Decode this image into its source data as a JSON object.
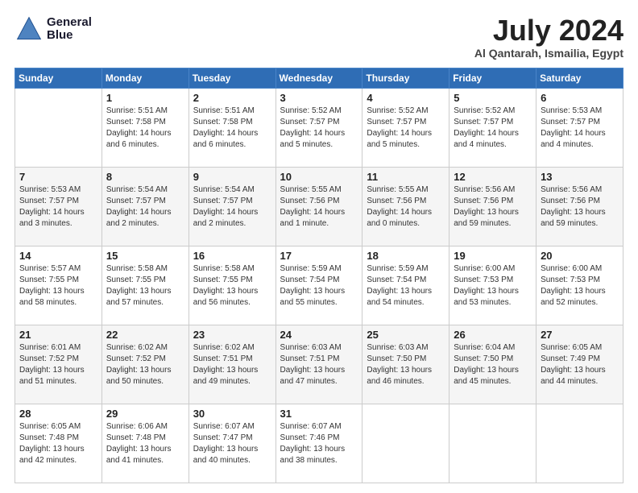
{
  "header": {
    "logo_line1": "General",
    "logo_line2": "Blue",
    "month_year": "July 2024",
    "location": "Al Qantarah, Ismailia, Egypt"
  },
  "weekdays": [
    "Sunday",
    "Monday",
    "Tuesday",
    "Wednesday",
    "Thursday",
    "Friday",
    "Saturday"
  ],
  "weeks": [
    [
      {
        "day": "",
        "sunrise": "",
        "sunset": "",
        "daylight": ""
      },
      {
        "day": "1",
        "sunrise": "Sunrise: 5:51 AM",
        "sunset": "Sunset: 7:58 PM",
        "daylight": "Daylight: 14 hours and 6 minutes."
      },
      {
        "day": "2",
        "sunrise": "Sunrise: 5:51 AM",
        "sunset": "Sunset: 7:58 PM",
        "daylight": "Daylight: 14 hours and 6 minutes."
      },
      {
        "day": "3",
        "sunrise": "Sunrise: 5:52 AM",
        "sunset": "Sunset: 7:57 PM",
        "daylight": "Daylight: 14 hours and 5 minutes."
      },
      {
        "day": "4",
        "sunrise": "Sunrise: 5:52 AM",
        "sunset": "Sunset: 7:57 PM",
        "daylight": "Daylight: 14 hours and 5 minutes."
      },
      {
        "day": "5",
        "sunrise": "Sunrise: 5:52 AM",
        "sunset": "Sunset: 7:57 PM",
        "daylight": "Daylight: 14 hours and 4 minutes."
      },
      {
        "day": "6",
        "sunrise": "Sunrise: 5:53 AM",
        "sunset": "Sunset: 7:57 PM",
        "daylight": "Daylight: 14 hours and 4 minutes."
      }
    ],
    [
      {
        "day": "7",
        "sunrise": "Sunrise: 5:53 AM",
        "sunset": "Sunset: 7:57 PM",
        "daylight": "Daylight: 14 hours and 3 minutes."
      },
      {
        "day": "8",
        "sunrise": "Sunrise: 5:54 AM",
        "sunset": "Sunset: 7:57 PM",
        "daylight": "Daylight: 14 hours and 2 minutes."
      },
      {
        "day": "9",
        "sunrise": "Sunrise: 5:54 AM",
        "sunset": "Sunset: 7:57 PM",
        "daylight": "Daylight: 14 hours and 2 minutes."
      },
      {
        "day": "10",
        "sunrise": "Sunrise: 5:55 AM",
        "sunset": "Sunset: 7:56 PM",
        "daylight": "Daylight: 14 hours and 1 minute."
      },
      {
        "day": "11",
        "sunrise": "Sunrise: 5:55 AM",
        "sunset": "Sunset: 7:56 PM",
        "daylight": "Daylight: 14 hours and 0 minutes."
      },
      {
        "day": "12",
        "sunrise": "Sunrise: 5:56 AM",
        "sunset": "Sunset: 7:56 PM",
        "daylight": "Daylight: 13 hours and 59 minutes."
      },
      {
        "day": "13",
        "sunrise": "Sunrise: 5:56 AM",
        "sunset": "Sunset: 7:56 PM",
        "daylight": "Daylight: 13 hours and 59 minutes."
      }
    ],
    [
      {
        "day": "14",
        "sunrise": "Sunrise: 5:57 AM",
        "sunset": "Sunset: 7:55 PM",
        "daylight": "Daylight: 13 hours and 58 minutes."
      },
      {
        "day": "15",
        "sunrise": "Sunrise: 5:58 AM",
        "sunset": "Sunset: 7:55 PM",
        "daylight": "Daylight: 13 hours and 57 minutes."
      },
      {
        "day": "16",
        "sunrise": "Sunrise: 5:58 AM",
        "sunset": "Sunset: 7:55 PM",
        "daylight": "Daylight: 13 hours and 56 minutes."
      },
      {
        "day": "17",
        "sunrise": "Sunrise: 5:59 AM",
        "sunset": "Sunset: 7:54 PM",
        "daylight": "Daylight: 13 hours and 55 minutes."
      },
      {
        "day": "18",
        "sunrise": "Sunrise: 5:59 AM",
        "sunset": "Sunset: 7:54 PM",
        "daylight": "Daylight: 13 hours and 54 minutes."
      },
      {
        "day": "19",
        "sunrise": "Sunrise: 6:00 AM",
        "sunset": "Sunset: 7:53 PM",
        "daylight": "Daylight: 13 hours and 53 minutes."
      },
      {
        "day": "20",
        "sunrise": "Sunrise: 6:00 AM",
        "sunset": "Sunset: 7:53 PM",
        "daylight": "Daylight: 13 hours and 52 minutes."
      }
    ],
    [
      {
        "day": "21",
        "sunrise": "Sunrise: 6:01 AM",
        "sunset": "Sunset: 7:52 PM",
        "daylight": "Daylight: 13 hours and 51 minutes."
      },
      {
        "day": "22",
        "sunrise": "Sunrise: 6:02 AM",
        "sunset": "Sunset: 7:52 PM",
        "daylight": "Daylight: 13 hours and 50 minutes."
      },
      {
        "day": "23",
        "sunrise": "Sunrise: 6:02 AM",
        "sunset": "Sunset: 7:51 PM",
        "daylight": "Daylight: 13 hours and 49 minutes."
      },
      {
        "day": "24",
        "sunrise": "Sunrise: 6:03 AM",
        "sunset": "Sunset: 7:51 PM",
        "daylight": "Daylight: 13 hours and 47 minutes."
      },
      {
        "day": "25",
        "sunrise": "Sunrise: 6:03 AM",
        "sunset": "Sunset: 7:50 PM",
        "daylight": "Daylight: 13 hours and 46 minutes."
      },
      {
        "day": "26",
        "sunrise": "Sunrise: 6:04 AM",
        "sunset": "Sunset: 7:50 PM",
        "daylight": "Daylight: 13 hours and 45 minutes."
      },
      {
        "day": "27",
        "sunrise": "Sunrise: 6:05 AM",
        "sunset": "Sunset: 7:49 PM",
        "daylight": "Daylight: 13 hours and 44 minutes."
      }
    ],
    [
      {
        "day": "28",
        "sunrise": "Sunrise: 6:05 AM",
        "sunset": "Sunset: 7:48 PM",
        "daylight": "Daylight: 13 hours and 42 minutes."
      },
      {
        "day": "29",
        "sunrise": "Sunrise: 6:06 AM",
        "sunset": "Sunset: 7:48 PM",
        "daylight": "Daylight: 13 hours and 41 minutes."
      },
      {
        "day": "30",
        "sunrise": "Sunrise: 6:07 AM",
        "sunset": "Sunset: 7:47 PM",
        "daylight": "Daylight: 13 hours and 40 minutes."
      },
      {
        "day": "31",
        "sunrise": "Sunrise: 6:07 AM",
        "sunset": "Sunset: 7:46 PM",
        "daylight": "Daylight: 13 hours and 38 minutes."
      },
      {
        "day": "",
        "sunrise": "",
        "sunset": "",
        "daylight": ""
      },
      {
        "day": "",
        "sunrise": "",
        "sunset": "",
        "daylight": ""
      },
      {
        "day": "",
        "sunrise": "",
        "sunset": "",
        "daylight": ""
      }
    ]
  ]
}
